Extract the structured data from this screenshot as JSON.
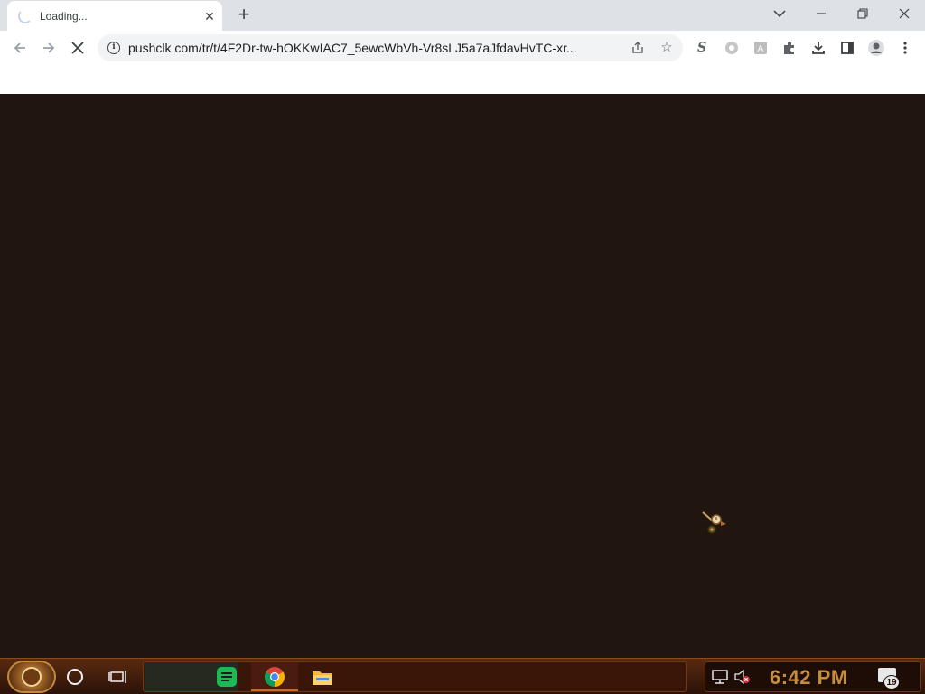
{
  "browser": {
    "tab": {
      "title": "Loading...",
      "close_icon": "close-icon",
      "loading_icon": "spinner-icon"
    },
    "new_tab_icon": "plus-icon",
    "window_controls": {
      "tab_search": "chevron-down-icon",
      "minimize": "minimize-icon",
      "restore": "restore-icon",
      "close": "close-icon"
    },
    "toolbar": {
      "back_icon": "arrow-left-icon",
      "forward_icon": "arrow-right-icon",
      "stop_icon": "stop-loading-icon",
      "url": "pushclk.com/tr/t/4F2Dr-tw-hOKKwIAC7_5ewcWbVh-Vr8sLJ5a7aJfdavHvTC-xr...",
      "share_icon": "share-icon",
      "bookmark_icon": "star-icon",
      "extensions": [
        "s-extension-icon",
        "grey-circle-extension-icon",
        "a-extension-icon",
        "puzzle-icon"
      ],
      "download_icon": "download-icon",
      "side_panel_icon": "side-panel-icon",
      "profile_icon": "profile-icon",
      "menu_icon": "more-vertical-icon"
    }
  },
  "taskbar": {
    "start_icon": "steampunk-start-icon",
    "cortana_icon": "cortana-circle-icon",
    "taskview_icon": "task-view-icon",
    "apps": [
      "chat-app-icon",
      "chrome-icon",
      "file-explorer-icon"
    ],
    "tray": {
      "network_icon": "network-icon",
      "volume_icon": "volume-muted-icon",
      "time": "6:42 PM",
      "notifications_icon": "notifications-icon",
      "notification_count": "19"
    }
  },
  "colors": {
    "page_background": "#21150f",
    "clock": "#c78d3c"
  }
}
